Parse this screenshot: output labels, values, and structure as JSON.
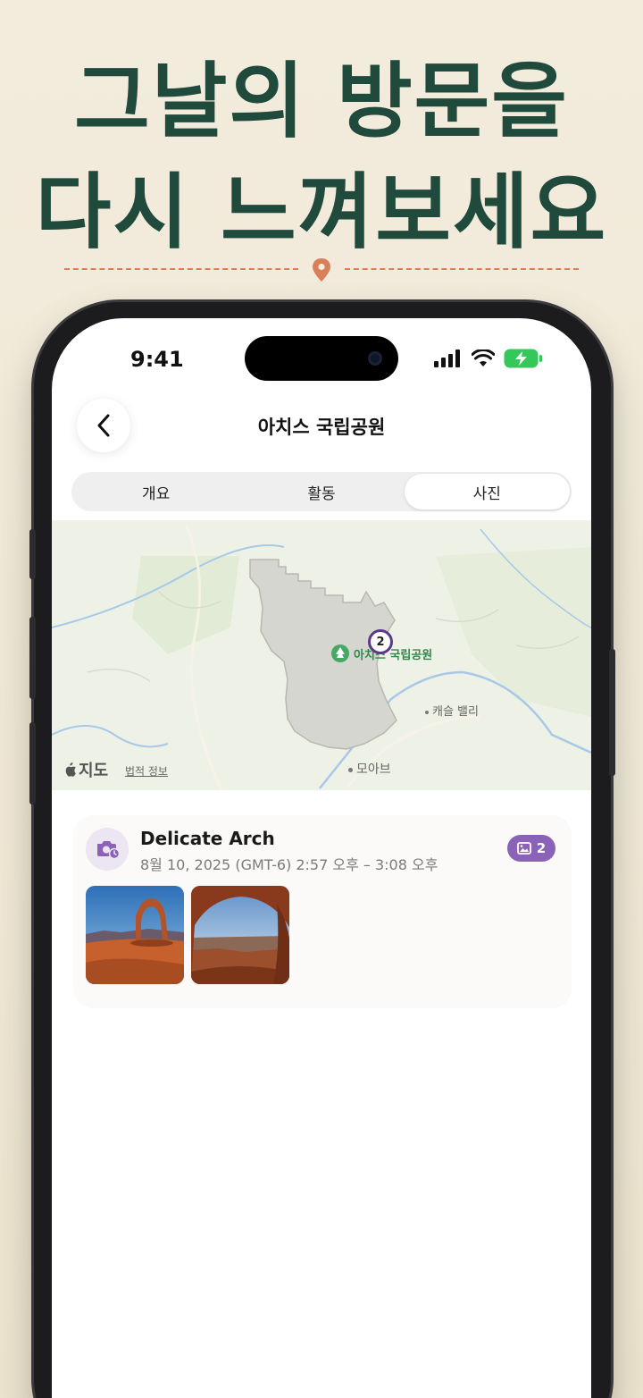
{
  "promo": {
    "headline_line1": "그날의 방문을",
    "headline_line2": "다시 느껴보세요"
  },
  "status_bar": {
    "time": "9:41"
  },
  "nav": {
    "title": "아치스 국립공원"
  },
  "tabs": [
    {
      "label": "개요",
      "active": false
    },
    {
      "label": "활동",
      "active": false
    },
    {
      "label": "사진",
      "active": true
    }
  ],
  "map": {
    "park_label": "아치스 국립공원",
    "cluster_count": "2",
    "place_castle_valley": "캐슬 밸리",
    "place_moab": "모아브",
    "attribution": "지도",
    "legal_link": "법적 정보"
  },
  "visit": {
    "title": "Delicate Arch",
    "datetime": "8월 10, 2025 (GMT-6) 2:57 오후 – 3:08 오후",
    "photo_count": "2",
    "photos": [
      "delicate-arch-photo",
      "mesa-arch-photo"
    ]
  },
  "colors": {
    "headline": "#1f4a3c",
    "accent_purple": "#8a63b8",
    "pin": "#d9805a"
  }
}
